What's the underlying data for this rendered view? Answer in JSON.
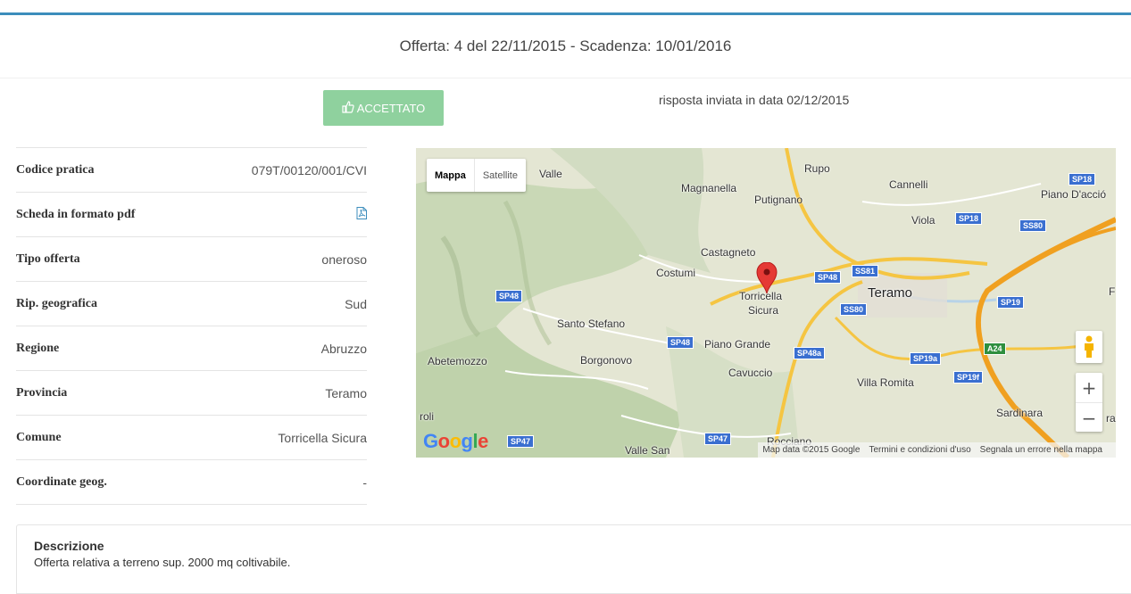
{
  "header": {
    "title": "Offerta: 4 del 22/11/2015 - Scadenza: 10/01/2016"
  },
  "status": {
    "button_label": "ACCETTATO",
    "response_text": "risposta inviata in data 02/12/2015",
    "color": "#8fd19e"
  },
  "details": [
    {
      "label": "Codice pratica",
      "value": "079T/00120/001/CVI"
    },
    {
      "label": "Scheda in formato pdf",
      "value": "",
      "icon": "pdf-icon"
    },
    {
      "label": "Tipo offerta",
      "value": "oneroso"
    },
    {
      "label": "Rip. geografica",
      "value": "Sud"
    },
    {
      "label": "Regione",
      "value": "Abruzzo"
    },
    {
      "label": "Provincia",
      "value": "Teramo"
    },
    {
      "label": "Comune",
      "value": "Torricella Sicura"
    },
    {
      "label": "Coordinate geog.",
      "value": "-"
    }
  ],
  "map": {
    "type_controls": [
      "Mappa",
      "Satellite"
    ],
    "active_type": "Mappa",
    "places": [
      "Valle",
      "Rupo",
      "Magnanella",
      "Putignano",
      "Cannelli",
      "Piano D'acció",
      "Viola",
      "Castagneto",
      "Costumi",
      "Torricella",
      "Sicura",
      "Teramo",
      "Santo Stefano",
      "Piano Grande",
      "Abetemozzo",
      "Borgonovo",
      "Cavuccio",
      "Villa Romita",
      "Sardinara",
      "roli",
      "Rocciano",
      "Valle San",
      "F",
      "ra"
    ],
    "road_shields": [
      "SP18",
      "SP18",
      "SS80",
      "SP48",
      "SS81",
      "SP48",
      "SS80",
      "SP19",
      "SP48",
      "SP48a",
      "SP19a",
      "A24",
      "SP19f",
      "SP47",
      "SP47"
    ],
    "logo": "Google",
    "attribution": [
      "Map data ©2015 Google",
      "Termini e condizioni d'uso",
      "Segnala un errore nella mappa"
    ],
    "zoom_in": "+",
    "zoom_out": "−"
  },
  "description": {
    "title": "Descrizione",
    "text": "Offerta relativa a terreno sup. 2000 mq coltivabile."
  },
  "colors": {
    "accent": "#3c8dbc",
    "shield_blue": "#3a6fd0",
    "road_yellow": "#f5c542",
    "road_orange": "#f0a020"
  }
}
